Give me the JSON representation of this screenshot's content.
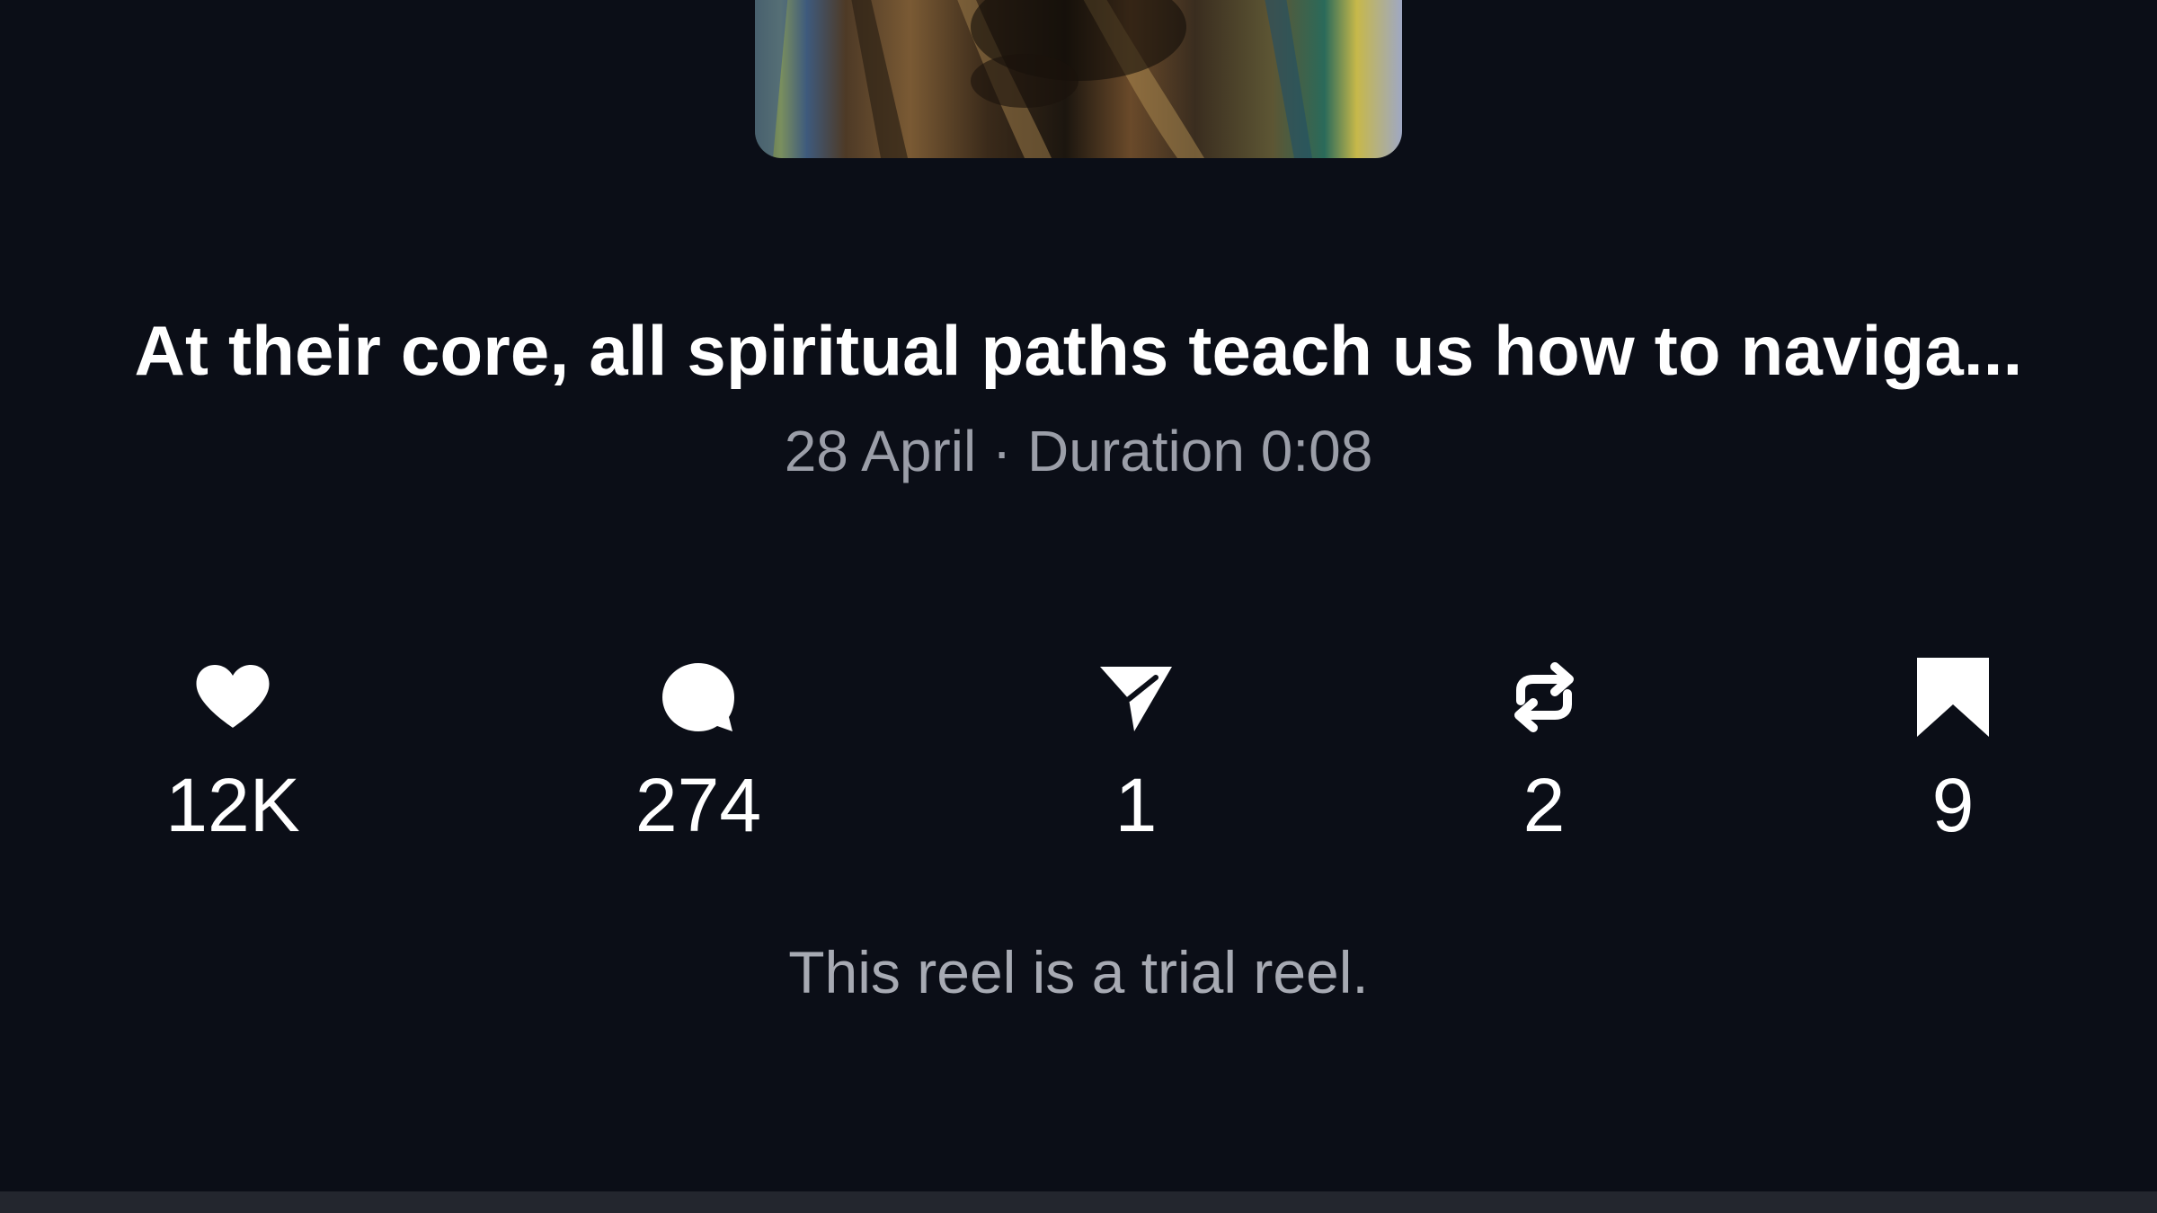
{
  "reel": {
    "thumbnail_icon": "reel-thumbnail-image",
    "title": "At their core, all spiritual paths teach us how to naviga...",
    "meta": "28 April · Duration 0:08",
    "note": "This reel is a trial reel."
  },
  "stats": [
    {
      "icon": "heart-icon",
      "count": "12K"
    },
    {
      "icon": "comment-icon",
      "count": "274"
    },
    {
      "icon": "send-icon",
      "count": "1"
    },
    {
      "icon": "repost-icon",
      "count": "2"
    },
    {
      "icon": "bookmark-icon",
      "count": "9"
    }
  ],
  "colors": {
    "background": "#0b0e17",
    "text_primary": "#ffffff",
    "text_secondary": "#9b9ea8"
  }
}
